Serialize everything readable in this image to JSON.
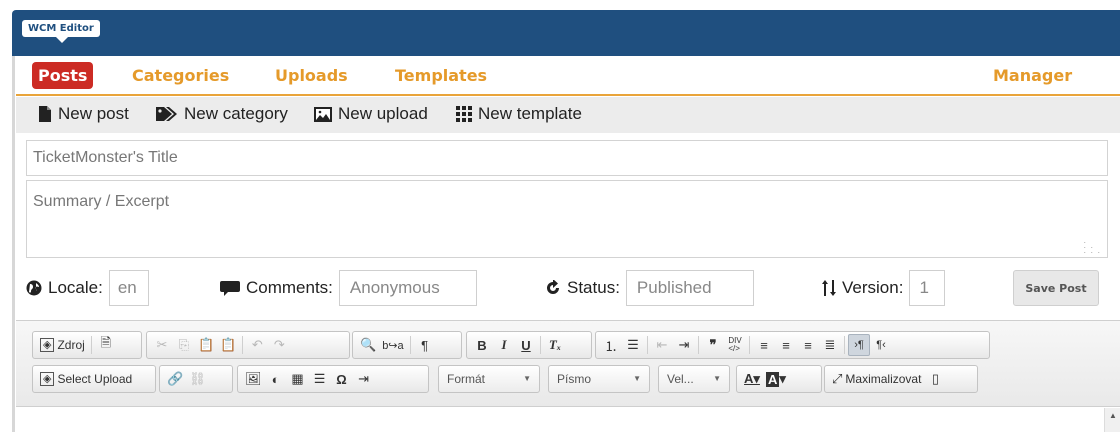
{
  "app": {
    "brand": "WCM Editor"
  },
  "nav": {
    "tabs": [
      "Posts",
      "Categories",
      "Uploads",
      "Templates"
    ],
    "right": "Manager"
  },
  "subnav": {
    "new_post": "New post",
    "new_category": "New category",
    "new_upload": "New upload",
    "new_template": "New template"
  },
  "form": {
    "title_placeholder": "TicketMonster's Title",
    "summary_placeholder": "Summary / Excerpt",
    "locale_label": "Locale:",
    "locale_value": "en",
    "comments_label": "Comments:",
    "comments_value": "Anonymous",
    "status_label": "Status:",
    "status_value": "Published",
    "version_label": "Version:",
    "version_value": "1",
    "save_label": "Save Post"
  },
  "editor": {
    "source_label": "Zdroj",
    "select_upload_label": "Select Upload",
    "format_label": "Formát",
    "font_label": "Písmo",
    "size_label": "Vel...",
    "maximize_label": "Maximalizovat"
  },
  "colors": {
    "header": "#1f4f7f",
    "nav_accent": "#e59a2a",
    "active_tab": "#cc2b24"
  }
}
